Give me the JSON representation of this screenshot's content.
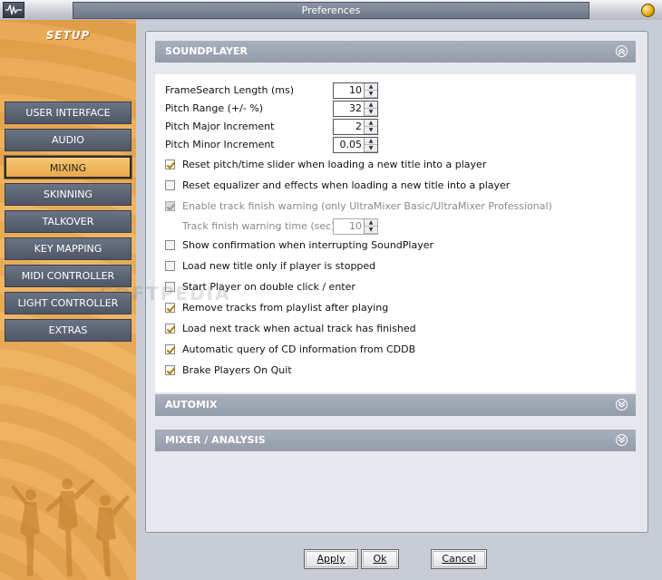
{
  "window": {
    "title": "Preferences"
  },
  "sidebar": {
    "heading": "SETUP",
    "items": [
      {
        "label": "USER INTERFACE",
        "active": false
      },
      {
        "label": "AUDIO",
        "active": false
      },
      {
        "label": "MIXING",
        "active": true
      },
      {
        "label": "SKINNING",
        "active": false
      },
      {
        "label": "TALKOVER",
        "active": false
      },
      {
        "label": "KEY MAPPING",
        "active": false
      },
      {
        "label": "MIDI CONTROLLER",
        "active": false
      },
      {
        "label": "LIGHT CONTROLLER",
        "active": false
      },
      {
        "label": "EXTRAS",
        "active": false
      }
    ]
  },
  "soundplayer": {
    "title": "SOUNDPLAYER",
    "fields": [
      {
        "label": "FrameSearch Length (ms)",
        "value": "10"
      },
      {
        "label": "Pitch Range (+/- %)",
        "value": "32"
      },
      {
        "label": "Pitch Major Increment",
        "value": "2"
      },
      {
        "label": "Pitch Minor Increment",
        "value": "0.05"
      }
    ],
    "options": [
      {
        "label": "Reset pitch/time slider when loading a new title into a player",
        "checked": true
      },
      {
        "label": "Reset equalizer and effects when loading a new title into a player",
        "checked": false
      },
      {
        "label": "Enable track finish warning (only UltraMixer Basic/UltraMixer Professional)",
        "checked": true,
        "disabled": true
      }
    ],
    "warning_time": {
      "label": "Track finish warning time (sec)",
      "value": "10"
    },
    "options2": [
      {
        "label": "Show confirmation when interrupting SoundPlayer",
        "checked": false
      },
      {
        "label": "Load new title only if player is stopped",
        "checked": false
      },
      {
        "label": "Start Player on double click / enter",
        "checked": false
      },
      {
        "label": "Remove tracks from playlist after playing",
        "checked": true
      },
      {
        "label": "Load next track when actual track has finished",
        "checked": true
      },
      {
        "label": "Automatic query of CD information from CDDB",
        "checked": true
      },
      {
        "label": "Brake Players On Quit",
        "checked": true
      }
    ]
  },
  "automix": {
    "title": "AUTOMIX"
  },
  "mixer": {
    "title": "MIXER / ANALYSIS"
  },
  "buttons": {
    "apply": "Apply",
    "ok": "Ok",
    "cancel": "Cancel"
  },
  "watermark": "SOFTPEDIA"
}
